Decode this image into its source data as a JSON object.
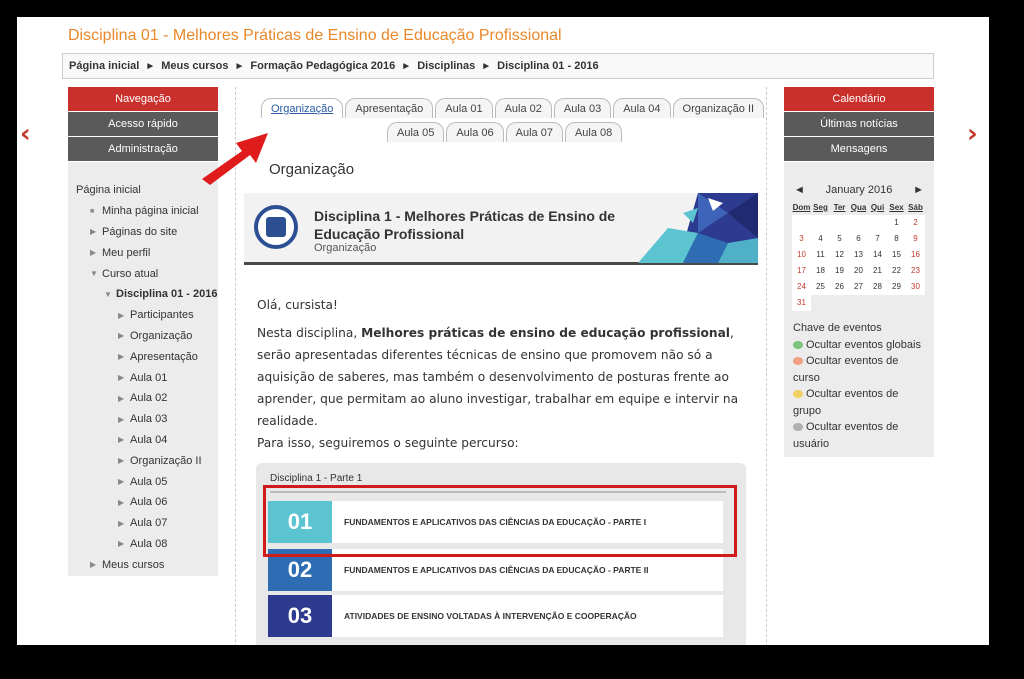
{
  "page": {
    "title": "Disciplina 01 - Melhores Práticas de Ensino de Educação Profissional"
  },
  "breadcrumb": [
    "Página inicial",
    "Meus cursos",
    "Formação Pedagógica 2016",
    "Disciplinas",
    "Disciplina 01 - 2016"
  ],
  "breadcrumb_sep": "►",
  "nav_arrows": {
    "prev": "‹",
    "next": "›"
  },
  "left_blocks": [
    "Navegação",
    "Acesso rápido",
    "Administração"
  ],
  "left_menu": {
    "items": [
      {
        "label": "Página inicial",
        "marker": "",
        "indent": 0
      },
      {
        "label": "Minha página inicial",
        "marker": "■",
        "indent": 1
      },
      {
        "label": "Páginas do site",
        "marker": "▶",
        "indent": 1
      },
      {
        "label": "Meu perfil",
        "marker": "▶",
        "indent": 1
      },
      {
        "label": "Curso atual",
        "marker": "▼",
        "indent": 1
      },
      {
        "label": "Disciplina 01 - 2016",
        "marker": "▼",
        "indent": 2,
        "bold": true
      },
      {
        "label": "Participantes",
        "marker": "▶",
        "indent": 3
      },
      {
        "label": "Organização",
        "marker": "▶",
        "indent": 3
      },
      {
        "label": "Apresentação",
        "marker": "▶",
        "indent": 3
      },
      {
        "label": "Aula 01",
        "marker": "▶",
        "indent": 3
      },
      {
        "label": "Aula 02",
        "marker": "▶",
        "indent": 3
      },
      {
        "label": "Aula 03",
        "marker": "▶",
        "indent": 3
      },
      {
        "label": "Aula 04",
        "marker": "▶",
        "indent": 3
      },
      {
        "label": "Organização II",
        "marker": "▶",
        "indent": 3
      },
      {
        "label": "Aula 05",
        "marker": "▶",
        "indent": 3
      },
      {
        "label": "Aula 06",
        "marker": "▶",
        "indent": 3
      },
      {
        "label": "Aula 07",
        "marker": "▶",
        "indent": 3
      },
      {
        "label": "Aula 08",
        "marker": "▶",
        "indent": 3
      },
      {
        "label": "Meus cursos",
        "marker": "▶",
        "indent": 1
      }
    ]
  },
  "tabs": {
    "row1": [
      "Organização",
      "Apresentação",
      "Aula 01",
      "Aula 02",
      "Aula 03",
      "Aula 04",
      "Organização II"
    ],
    "row2": [
      "Aula 05",
      "Aula 06",
      "Aula 07",
      "Aula 08"
    ],
    "active": "Organização"
  },
  "section": {
    "title": "Organização"
  },
  "banner": {
    "title": "Disciplina 1 - Melhores Práticas de Ensino de Educação Profissional",
    "subtitle": "Organização"
  },
  "intro": {
    "greeting": "Olá, cursista!",
    "p_before": "Nesta disciplina, ",
    "p_bold": "Melhores práticas de ensino de educação profissional",
    "p_after": ", serão apresentadas diferentes técnicas de ensino que promovem não só a aquisição de saberes, mas também o desenvolvimento de posturas frente ao aprender, que permitam ao aluno investigar, trabalhar em equipe e intervir na realidade.",
    "p2": "Para isso, seguiremos o seguinte percurso:"
  },
  "course_parts": {
    "heading": "Disciplina 1 - Parte 1",
    "items": [
      {
        "num": "01",
        "title": "FUNDAMENTOS E APLICATIVOS DAS CIÊNCIAS DA EDUCAÇÃO - PARTE I",
        "color": "#5bc4d0"
      },
      {
        "num": "02",
        "title": "FUNDAMENTOS E APLICATIVOS DAS CIÊNCIAS DA EDUCAÇÃO - PARTE II",
        "color": "#2e6db4"
      },
      {
        "num": "03",
        "title": "ATIVIDADES DE ENSINO VOLTADAS À INTERVENÇÃO E COOPERAÇÃO",
        "color": "#2c3a8f"
      }
    ]
  },
  "right_blocks": [
    "Calendário",
    "Últimas notícias",
    "Mensagens"
  ],
  "calendar": {
    "prev": "◄",
    "next": "►",
    "month": "January 2016",
    "weekdays": [
      "Dom",
      "Seg",
      "Ter",
      "Qua",
      "Qui",
      "Sex",
      "Sáb"
    ],
    "leading_blanks": 5,
    "days": 31,
    "today": 20
  },
  "events": {
    "title": "Chave de eventos",
    "items": [
      {
        "label": "Ocultar eventos globais",
        "color": "#7cc47c"
      },
      {
        "label": "Ocultar eventos de curso",
        "color": "#f0a080"
      },
      {
        "label": "Ocultar eventos de grupo",
        "color": "#f0d060"
      },
      {
        "label": "Ocultar eventos de usuário",
        "color": "#b0b0b0"
      }
    ]
  },
  "colors": {
    "title_orange": "#e8882a",
    "nav_red": "#c9302c",
    "block_gray": "#5a5a5a",
    "highlight_red": "#d01b1b"
  }
}
